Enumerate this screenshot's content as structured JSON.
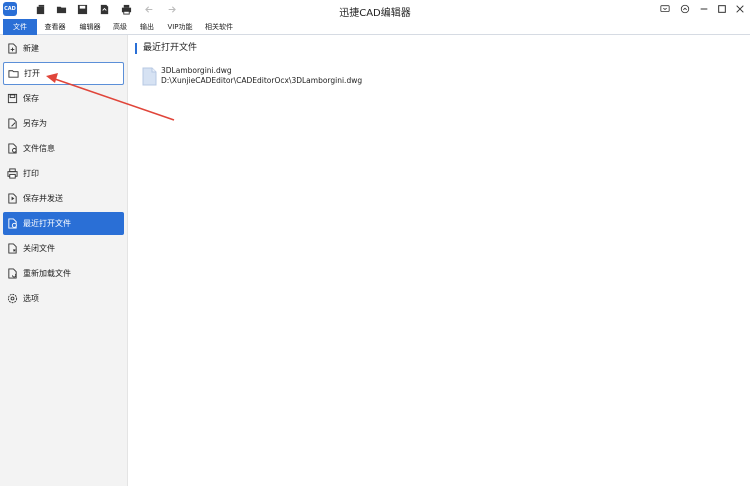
{
  "app": {
    "logo_text": "CAD",
    "title": "迅捷CAD编辑器"
  },
  "quick_access": [
    "new-file-icon",
    "open-folder-icon",
    "save-icon",
    "export-icon",
    "print-icon",
    "undo-icon",
    "redo-icon"
  ],
  "window_controls": [
    "feedback-icon",
    "settings-icon",
    "minimize-icon",
    "maximize-icon",
    "close-icon"
  ],
  "menu": {
    "items": [
      {
        "label": "文件",
        "active": true
      },
      {
        "label": "查看器"
      },
      {
        "label": "编辑器"
      },
      {
        "label": "高级"
      },
      {
        "label": "输出"
      },
      {
        "label": "VIP功能"
      },
      {
        "label": "相关软件"
      }
    ]
  },
  "sidebar": {
    "items": [
      {
        "label": "新建",
        "icon": "new-document-icon"
      },
      {
        "label": "打开",
        "icon": "open-folder-icon",
        "state": "hover"
      },
      {
        "label": "保存",
        "icon": "save-icon"
      },
      {
        "label": "另存为",
        "icon": "save-as-icon"
      },
      {
        "label": "文件信息",
        "icon": "file-info-icon"
      },
      {
        "label": "打印",
        "icon": "print-icon"
      },
      {
        "label": "保存并发送",
        "icon": "save-send-icon"
      },
      {
        "label": "最近打开文件",
        "icon": "recent-files-icon",
        "state": "selected"
      },
      {
        "label": "关闭文件",
        "icon": "close-file-icon"
      },
      {
        "label": "重新加载文件",
        "icon": "reload-file-icon"
      },
      {
        "label": "选项",
        "icon": "options-gear-icon"
      }
    ]
  },
  "main": {
    "section_title": "最近打开文件",
    "recent_files": [
      {
        "name": "3DLamborgini.dwg",
        "path": "D:\\XunjieCADEditor\\CADEditorOcx\\3DLamborgini.dwg"
      }
    ]
  },
  "colors": {
    "accent": "#2a6fd6",
    "annotation_arrow": "#e0453a",
    "sidebar_bg": "#f3f3f3"
  }
}
